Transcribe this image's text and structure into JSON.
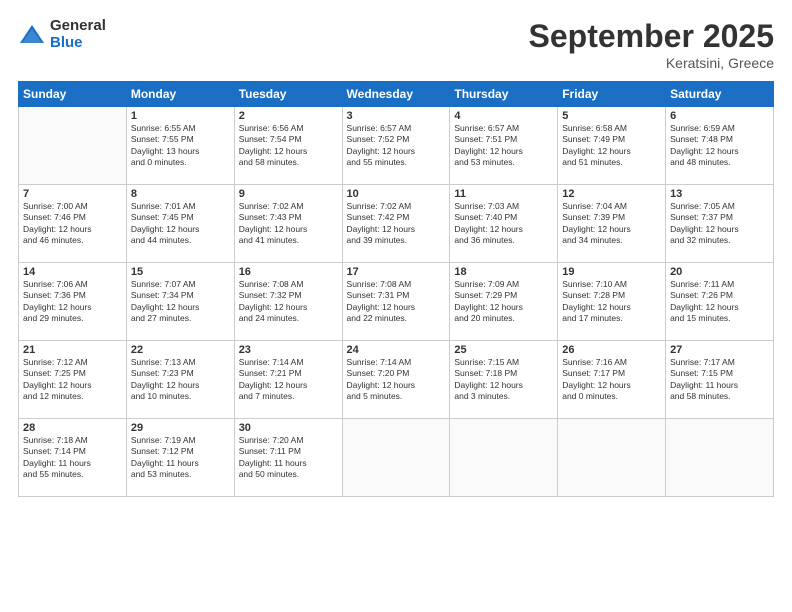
{
  "header": {
    "logo_general": "General",
    "logo_blue": "Blue",
    "title": "September 2025",
    "location": "Keratsini, Greece"
  },
  "days_of_week": [
    "Sunday",
    "Monday",
    "Tuesday",
    "Wednesday",
    "Thursday",
    "Friday",
    "Saturday"
  ],
  "weeks": [
    [
      {
        "day": "",
        "info": ""
      },
      {
        "day": "1",
        "info": "Sunrise: 6:55 AM\nSunset: 7:55 PM\nDaylight: 13 hours\nand 0 minutes."
      },
      {
        "day": "2",
        "info": "Sunrise: 6:56 AM\nSunset: 7:54 PM\nDaylight: 12 hours\nand 58 minutes."
      },
      {
        "day": "3",
        "info": "Sunrise: 6:57 AM\nSunset: 7:52 PM\nDaylight: 12 hours\nand 55 minutes."
      },
      {
        "day": "4",
        "info": "Sunrise: 6:57 AM\nSunset: 7:51 PM\nDaylight: 12 hours\nand 53 minutes."
      },
      {
        "day": "5",
        "info": "Sunrise: 6:58 AM\nSunset: 7:49 PM\nDaylight: 12 hours\nand 51 minutes."
      },
      {
        "day": "6",
        "info": "Sunrise: 6:59 AM\nSunset: 7:48 PM\nDaylight: 12 hours\nand 48 minutes."
      }
    ],
    [
      {
        "day": "7",
        "info": "Sunrise: 7:00 AM\nSunset: 7:46 PM\nDaylight: 12 hours\nand 46 minutes."
      },
      {
        "day": "8",
        "info": "Sunrise: 7:01 AM\nSunset: 7:45 PM\nDaylight: 12 hours\nand 44 minutes."
      },
      {
        "day": "9",
        "info": "Sunrise: 7:02 AM\nSunset: 7:43 PM\nDaylight: 12 hours\nand 41 minutes."
      },
      {
        "day": "10",
        "info": "Sunrise: 7:02 AM\nSunset: 7:42 PM\nDaylight: 12 hours\nand 39 minutes."
      },
      {
        "day": "11",
        "info": "Sunrise: 7:03 AM\nSunset: 7:40 PM\nDaylight: 12 hours\nand 36 minutes."
      },
      {
        "day": "12",
        "info": "Sunrise: 7:04 AM\nSunset: 7:39 PM\nDaylight: 12 hours\nand 34 minutes."
      },
      {
        "day": "13",
        "info": "Sunrise: 7:05 AM\nSunset: 7:37 PM\nDaylight: 12 hours\nand 32 minutes."
      }
    ],
    [
      {
        "day": "14",
        "info": "Sunrise: 7:06 AM\nSunset: 7:36 PM\nDaylight: 12 hours\nand 29 minutes."
      },
      {
        "day": "15",
        "info": "Sunrise: 7:07 AM\nSunset: 7:34 PM\nDaylight: 12 hours\nand 27 minutes."
      },
      {
        "day": "16",
        "info": "Sunrise: 7:08 AM\nSunset: 7:32 PM\nDaylight: 12 hours\nand 24 minutes."
      },
      {
        "day": "17",
        "info": "Sunrise: 7:08 AM\nSunset: 7:31 PM\nDaylight: 12 hours\nand 22 minutes."
      },
      {
        "day": "18",
        "info": "Sunrise: 7:09 AM\nSunset: 7:29 PM\nDaylight: 12 hours\nand 20 minutes."
      },
      {
        "day": "19",
        "info": "Sunrise: 7:10 AM\nSunset: 7:28 PM\nDaylight: 12 hours\nand 17 minutes."
      },
      {
        "day": "20",
        "info": "Sunrise: 7:11 AM\nSunset: 7:26 PM\nDaylight: 12 hours\nand 15 minutes."
      }
    ],
    [
      {
        "day": "21",
        "info": "Sunrise: 7:12 AM\nSunset: 7:25 PM\nDaylight: 12 hours\nand 12 minutes."
      },
      {
        "day": "22",
        "info": "Sunrise: 7:13 AM\nSunset: 7:23 PM\nDaylight: 12 hours\nand 10 minutes."
      },
      {
        "day": "23",
        "info": "Sunrise: 7:14 AM\nSunset: 7:21 PM\nDaylight: 12 hours\nand 7 minutes."
      },
      {
        "day": "24",
        "info": "Sunrise: 7:14 AM\nSunset: 7:20 PM\nDaylight: 12 hours\nand 5 minutes."
      },
      {
        "day": "25",
        "info": "Sunrise: 7:15 AM\nSunset: 7:18 PM\nDaylight: 12 hours\nand 3 minutes."
      },
      {
        "day": "26",
        "info": "Sunrise: 7:16 AM\nSunset: 7:17 PM\nDaylight: 12 hours\nand 0 minutes."
      },
      {
        "day": "27",
        "info": "Sunrise: 7:17 AM\nSunset: 7:15 PM\nDaylight: 11 hours\nand 58 minutes."
      }
    ],
    [
      {
        "day": "28",
        "info": "Sunrise: 7:18 AM\nSunset: 7:14 PM\nDaylight: 11 hours\nand 55 minutes."
      },
      {
        "day": "29",
        "info": "Sunrise: 7:19 AM\nSunset: 7:12 PM\nDaylight: 11 hours\nand 53 minutes."
      },
      {
        "day": "30",
        "info": "Sunrise: 7:20 AM\nSunset: 7:11 PM\nDaylight: 11 hours\nand 50 minutes."
      },
      {
        "day": "",
        "info": ""
      },
      {
        "day": "",
        "info": ""
      },
      {
        "day": "",
        "info": ""
      },
      {
        "day": "",
        "info": ""
      }
    ]
  ]
}
